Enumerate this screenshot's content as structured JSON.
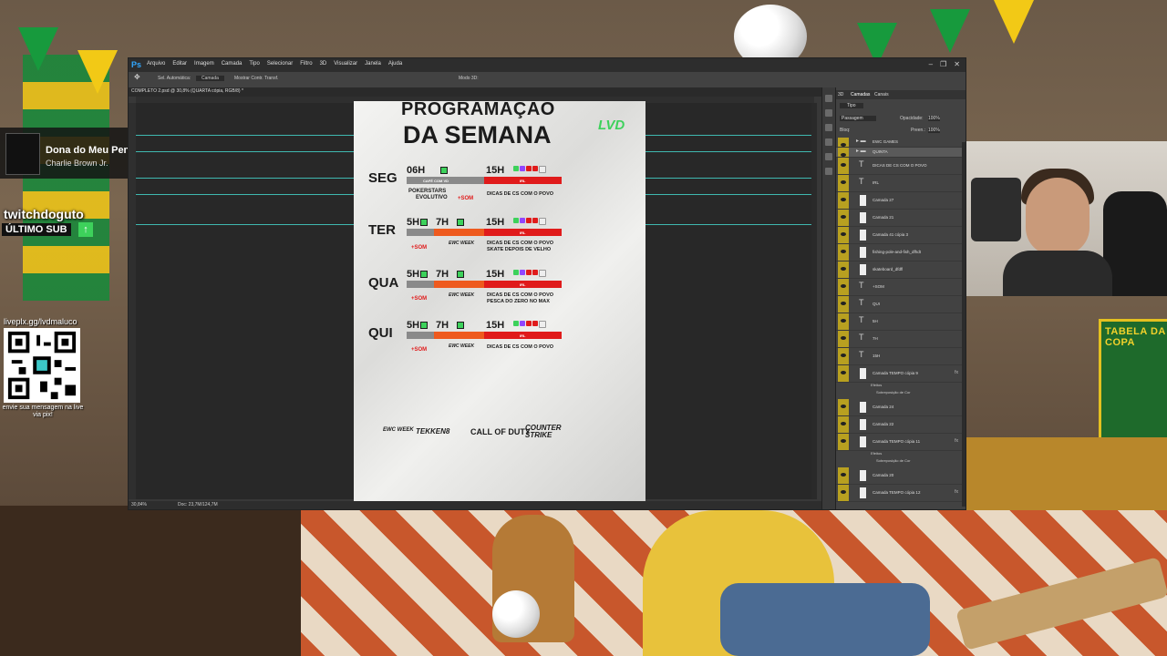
{
  "overlay": {
    "now_playing": {
      "title": "Dona do Meu Pen",
      "artist": "Charlie Brown Jr."
    },
    "last_sub": {
      "name": "twitchdoguto",
      "label": "ÚLTIMO SUB"
    },
    "qr": {
      "url": "liveplx.gg/lvdmaluco",
      "note": "envie sua mensagem na live via pix!"
    },
    "poster_title": "TABELA DA COPA"
  },
  "photoshop": {
    "logo": "Ps",
    "menu": [
      "Arquivo",
      "Editar",
      "Imagem",
      "Camada",
      "Tipo",
      "Selecionar",
      "Filtro",
      "3D",
      "Visualizar",
      "Janela",
      "Ajuda"
    ],
    "window_controls": [
      "–",
      "❐",
      "✕"
    ],
    "options": {
      "auto_select": "Sel. Automática:",
      "auto_select_value": "Camada",
      "show_transform": "Mostrar Contr. Transf.",
      "mode_3d": "Modo 3D:"
    },
    "document_tab": "COMPLETO 2.psd @ 30,8% (QUARTA cópia, RGB/8) *",
    "status": {
      "zoom": "30,84%",
      "doc": "Doc: 23,7M/124,7M"
    },
    "layers_panel": {
      "tabs": [
        "3D",
        "Camadas",
        "Canais"
      ],
      "filter": "Tipo",
      "blend_mode": "Passagem",
      "opacity_label": "Opacidade:",
      "opacity": "100%",
      "lock_label": "Bloq:",
      "fill_label": "Preen.:",
      "fill": "100%",
      "layers": [
        {
          "name": "EWC GAMES",
          "kind": "group"
        },
        {
          "name": "QUINTA",
          "kind": "group"
        },
        {
          "name": "DICAS DE CS COM O POVO",
          "kind": "text"
        },
        {
          "name": "IRL",
          "kind": "text"
        },
        {
          "name": "Camada 27",
          "kind": "pixel"
        },
        {
          "name": "Camada 21",
          "kind": "pixel"
        },
        {
          "name": "Camada 41 cópia 3",
          "kind": "pixel"
        },
        {
          "name": "fishing-pole-and-fish_dfhdt",
          "kind": "pixel"
        },
        {
          "name": "skateboard_dfdfl",
          "kind": "pixel"
        },
        {
          "name": "+SOM",
          "kind": "text"
        },
        {
          "name": "QUI",
          "kind": "text"
        },
        {
          "name": "5H",
          "kind": "text"
        },
        {
          "name": "7H",
          "kind": "text"
        },
        {
          "name": "15H",
          "kind": "text"
        },
        {
          "name": "Camada TEMPO cópia 9",
          "kind": "pixel",
          "fx": true,
          "effects": [
            "Efeitos",
            "Sobreposição de Cor"
          ]
        },
        {
          "name": "Camada 24",
          "kind": "pixel"
        },
        {
          "name": "Camada 22",
          "kind": "pixel"
        },
        {
          "name": "Camada TEMPO cópia 11",
          "kind": "pixel",
          "fx": true,
          "effects": [
            "Efeitos",
            "Sobreposição de Cor"
          ]
        },
        {
          "name": "Camada 20",
          "kind": "pixel"
        },
        {
          "name": "Camada TEMPO cópia 12",
          "kind": "pixel",
          "fx": true
        }
      ]
    }
  },
  "schedule": {
    "title_line1": "PROGRAMAÇÃO",
    "title_line2": "DA SEMANA",
    "brand": "LVD",
    "days": [
      {
        "day": "SEG",
        "t1": "06H",
        "t2": "15H",
        "bar1": "CAFÉ COM VD",
        "bar2": "IRL",
        "sponsor_line1": "POKERSTARS",
        "sponsor_line2": "EVOLUTIVO",
        "som": "+SOM",
        "tip1": "DICAS DE CS COM O POVO",
        "tip2": ""
      },
      {
        "day": "TER",
        "t1": "5H",
        "t2": "7H",
        "t3": "15H",
        "bar2": "IRL",
        "som": "+SOM",
        "ewc": "EWC WEEK",
        "tip1": "DICAS DE CS COM O POVO",
        "tip2": "SKATE DEPOIS DE VELHO"
      },
      {
        "day": "QUA",
        "t1": "5H",
        "t2": "7H",
        "t3": "15H",
        "bar2": "IRL",
        "som": "+SOM",
        "ewc": "EWC WEEK",
        "tip1": "DICAS DE CS COM O POVO",
        "tip2": "PESCA DO ZERO NO MAX"
      },
      {
        "day": "QUI",
        "t1": "5H",
        "t2": "7H",
        "t3": "15H",
        "bar2": "IRL",
        "som": "+SOM",
        "ewc": "EWC WEEK",
        "tip1": "DICAS DE CS COM O POVO",
        "tip2": ""
      }
    ],
    "footer_logos": [
      "EWC WEEK",
      "TEKKEN8",
      "CALL OF DUTY",
      "COUNTER STRIKE"
    ]
  },
  "colors": {
    "accent_green": "#3dd15b",
    "accent_red": "#e01b1b",
    "accent_orange": "#ee5a1e",
    "ps_blue": "#31a8ff",
    "guide_cyan": "#3fb8b0"
  }
}
